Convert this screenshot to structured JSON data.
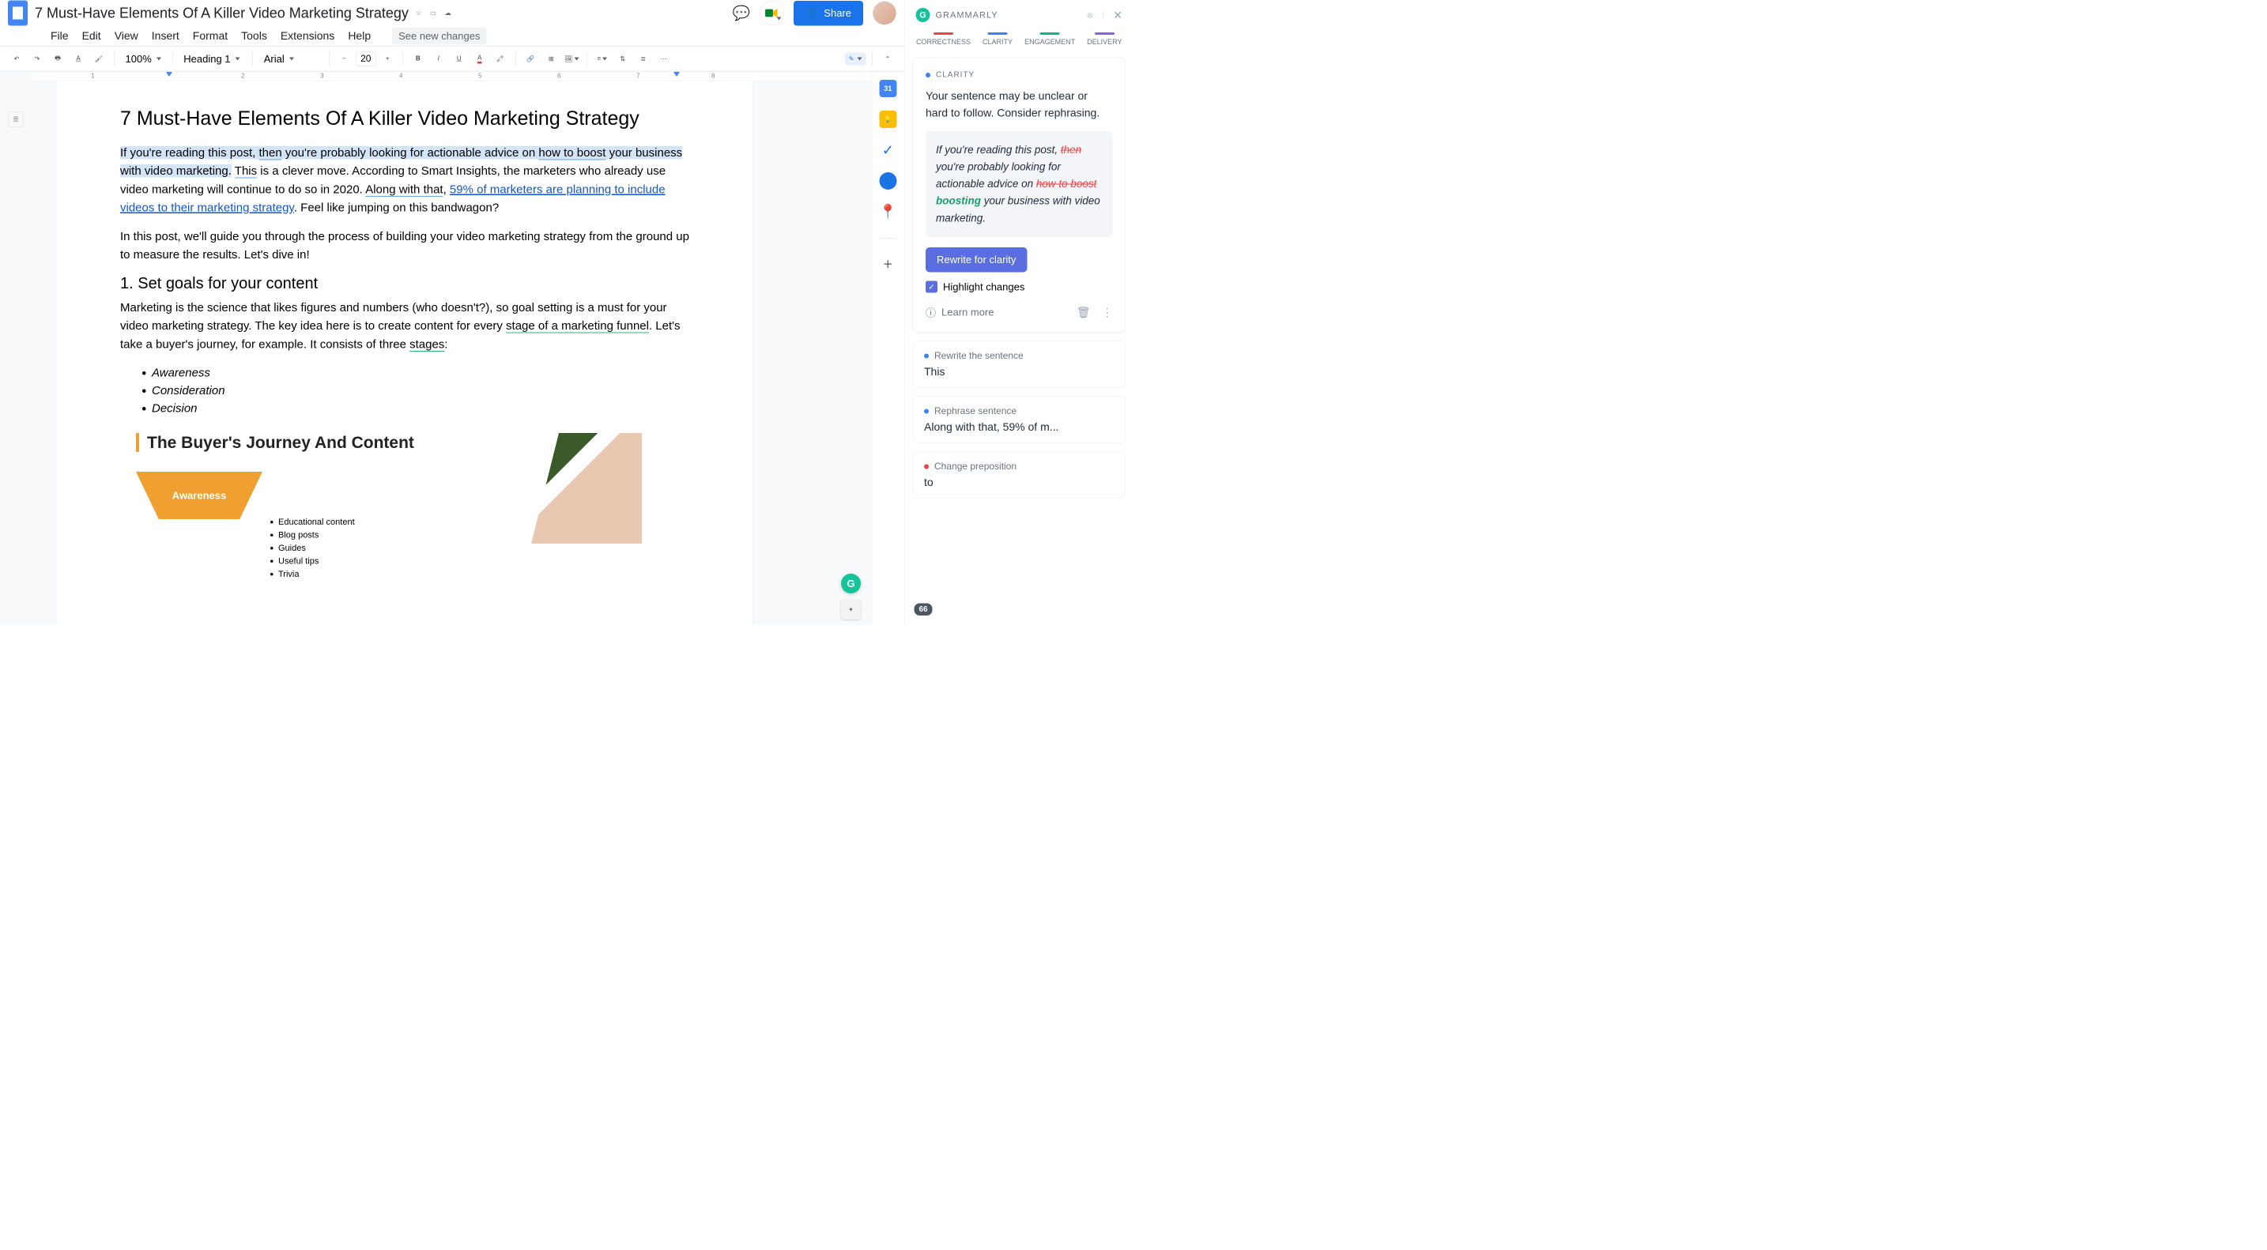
{
  "docTitle": "7 Must-Have Elements Of A Killer Video Marketing Strategy",
  "menu": {
    "file": "File",
    "edit": "Edit",
    "view": "View",
    "insert": "Insert",
    "format": "Format",
    "tools": "Tools",
    "extensions": "Extensions",
    "help": "Help",
    "seeChanges": "See new changes"
  },
  "share": "Share",
  "toolbar": {
    "zoom": "100%",
    "style": "Heading 1",
    "font": "Arial",
    "size": "20"
  },
  "doc": {
    "h1": "7 Must-Have Elements Of A Killer Video Marketing Strategy",
    "p1a": "If you're reading this post, ",
    "p1then": "then",
    "p1b": " you're probably looking for actionable advice on ",
    "p1boost": "how to boost",
    "p1c": " your business with video marketing.",
    "p1d": " ",
    "p1this": "This",
    "p1e": " is a clever move. According to Smart Insights, the marketers who already use video marketing will continue to do so in 2020. ",
    "p1along": "Along with that",
    "p1f": ", ",
    "p1link": "59% of marketers are planning to include videos to their marketing strategy",
    "p1g": ". Feel like jumping on this bandwagon?",
    "p2": "In this post, we'll guide you through the process of building your video marketing strategy from the ground up to measure the results. Let's dive in!",
    "h2": "1. Set goals for your content",
    "p3a": "Marketing is the science that likes figures and numbers (who doesn't?), so goal setting is a must for your video marketing strategy. The key idea here is to create content for every ",
    "p3stage": "stage of a marketing funnel",
    "p3b": ". Let's take a buyer's journey, for example. It consists of three ",
    "p3stages": "stages",
    "p3c": ":",
    "li1": "Awareness",
    "li2": "Consideration",
    "li3": "Decision",
    "graphicTitle": "The Buyer's Journey And Content",
    "funnelLabel": "Awareness",
    "gl1": "Educational content",
    "gl2": "Blog posts",
    "gl3": "Guides",
    "gl4": "Useful tips",
    "gl5": "Trivia"
  },
  "sideCal": "31",
  "grammarly": {
    "brand": "GRAMMARLY",
    "tabs": {
      "correctness": "CORRECTNESS",
      "clarity": "CLARITY",
      "engagement": "ENGAGEMENT",
      "delivery": "DELIVERY"
    },
    "card1": {
      "label": "CLARITY",
      "msg": "Your sentence may be unclear or hard to follow. Consider rephrasing.",
      "sug_a": "If you're reading this post, ",
      "sug_then": "then ",
      "sug_b": "you're probably looking for actionable advice on ",
      "sug_how": "how to boost",
      "sug_sp": " ",
      "sug_boosting": "boosting",
      "sug_c": " your business with video marketing.",
      "btn": "Rewrite for clarity",
      "highlight": "Highlight changes",
      "learn": "Learn more"
    },
    "card2": {
      "label": "Rewrite the sentence",
      "text": "This"
    },
    "card3": {
      "label": "Rephrase sentence",
      "text": "Along with that, 59% of m..."
    },
    "card4": {
      "label": "Change preposition",
      "text": "to"
    },
    "count": "66"
  }
}
